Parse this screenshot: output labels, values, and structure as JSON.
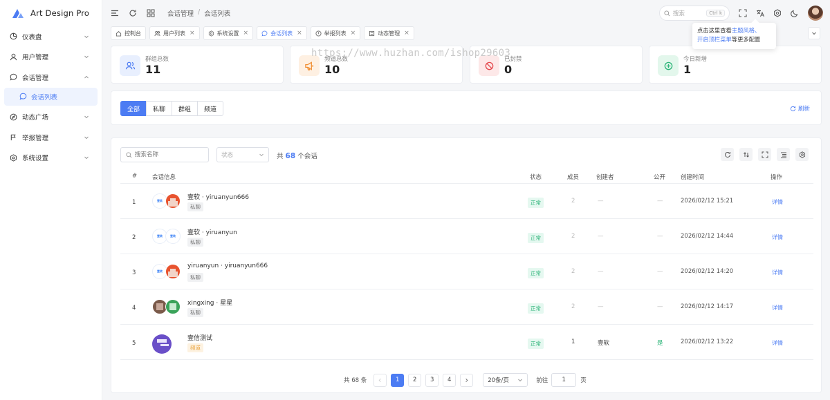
{
  "app": {
    "name": "Art Design Pro",
    "brand_color": "#4c7cf3"
  },
  "sidebar": {
    "items": [
      {
        "label": "仪表盘",
        "icon": "dashboard-icon"
      },
      {
        "label": "用户管理",
        "icon": "user-icon"
      },
      {
        "label": "会话管理",
        "icon": "chat-icon",
        "expanded": true
      },
      {
        "label": "会话列表",
        "icon": "chat-icon",
        "active": true
      },
      {
        "label": "动态广场",
        "icon": "compass-icon"
      },
      {
        "label": "举报管理",
        "icon": "flag-icon"
      },
      {
        "label": "系统设置",
        "icon": "gear-icon"
      }
    ]
  },
  "header": {
    "breadcrumb": [
      "会话管理",
      "会话列表"
    ],
    "search_placeholder": "搜索",
    "search_shortcut": "Ctrl k"
  },
  "tabs": [
    {
      "label": "控制台",
      "closable": false
    },
    {
      "label": "用户列表",
      "closable": true
    },
    {
      "label": "系统设置",
      "closable": true
    },
    {
      "label": "会话列表",
      "closable": true,
      "active": true
    },
    {
      "label": "举报列表",
      "closable": true
    },
    {
      "label": "动态管理",
      "closable": true
    }
  ],
  "tooltip": {
    "line1_prefix": "点击这里查看",
    "line1_link": "主题风格",
    "line1_sep": "、",
    "line2_link": "开启顶栏菜单",
    "line2_suffix": "等更多配置"
  },
  "watermark": "https://www.huzhan.com/ishop29603",
  "stats": [
    {
      "label": "群组总数",
      "value": "11",
      "color": "#4c7cf3",
      "bg": "#e8effe",
      "icon": "users-icon"
    },
    {
      "label": "频道总数",
      "value": "10",
      "color": "#f08c2e",
      "bg": "#fef0e2",
      "icon": "megaphone-icon"
    },
    {
      "label": "已封禁",
      "value": "0",
      "color": "#e5484d",
      "bg": "#fde8e8",
      "icon": "ban-icon"
    },
    {
      "label": "今日新增",
      "value": "1",
      "color": "#2fb57a",
      "bg": "#e3f7ec",
      "icon": "plus-circle-icon"
    }
  ],
  "filter": {
    "segments": [
      "全部",
      "私聊",
      "群组",
      "频道"
    ],
    "active_segment": "全部",
    "refresh_label": "刷新"
  },
  "table": {
    "search_placeholder": "搜索名称",
    "status_placeholder": "状态",
    "count_prefix": "共",
    "count": "68",
    "count_suffix": "个会话",
    "columns": [
      "#",
      "会话信息",
      "状态",
      "成员",
      "创建者",
      "公开",
      "创建时间",
      "操作"
    ],
    "rows": [
      {
        "no": "1",
        "name": "壹软 · yiruanyun666",
        "type": "私聊",
        "status": "正常",
        "members": "2",
        "creator": "—",
        "public": "—",
        "time": "2026/02/12 15:21",
        "action": "详情",
        "avatars": [
          "logo",
          "orange"
        ]
      },
      {
        "no": "2",
        "name": "壹软 · yiruanyun",
        "type": "私聊",
        "status": "正常",
        "members": "2",
        "creator": "—",
        "public": "—",
        "time": "2026/02/12 14:44",
        "action": "详情",
        "avatars": [
          "logo",
          "logo"
        ]
      },
      {
        "no": "3",
        "name": "yiruanyun · yiruanyun666",
        "type": "私聊",
        "status": "正常",
        "members": "2",
        "creator": "—",
        "public": "—",
        "time": "2026/02/12 14:20",
        "action": "详情",
        "avatars": [
          "logo",
          "orange"
        ]
      },
      {
        "no": "4",
        "name": "xingxing · 星星",
        "type": "私聊",
        "status": "正常",
        "members": "2",
        "creator": "—",
        "public": "—",
        "time": "2026/02/12 14:17",
        "action": "详情",
        "avatars": [
          "brown",
          "green"
        ]
      },
      {
        "no": "5",
        "name": "壹信测试",
        "type": "频道",
        "status": "正常",
        "members": "1",
        "creator": "壹软",
        "public": "是",
        "time": "2026/02/12 13:22",
        "action": "详情",
        "avatars": [
          "big"
        ]
      }
    ],
    "logo_text": "壹软"
  },
  "pager": {
    "total": "共 68 条",
    "pages": [
      "1",
      "2",
      "3",
      "4"
    ],
    "current": "1",
    "page_size": "20条/页",
    "goto_label": "前往",
    "goto_value": "1",
    "page_unit": "页"
  }
}
